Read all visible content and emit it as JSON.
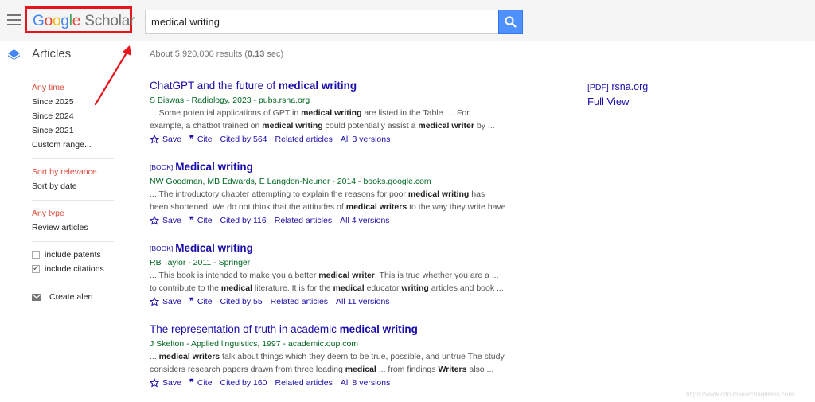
{
  "header": {
    "logo_google": "Google",
    "logo_scholar": "Scholar",
    "search_value": "medical writing"
  },
  "colors": {
    "logo_blue": "#4285f4",
    "logo_red": "#ea4335",
    "logo_yellow": "#fbbc05",
    "logo_green": "#34a853",
    "annotation_red": "#e8141c",
    "search_button": "#4d90fe",
    "link": "#1a0dab",
    "meta_green": "#006621",
    "active_filter": "#dd4b39"
  },
  "icons": {
    "menu": "hamburger-menu-icon",
    "search": "search-icon",
    "articles": "articles-icon",
    "save": "star-icon",
    "cite": "quote-icon",
    "alert": "envelope-icon",
    "annotation": "red-arrow-annotation"
  },
  "section_label": "Articles",
  "result_count": {
    "prefix": "About 5,920,000 results (",
    "time": "0.13",
    "suffix": " sec)"
  },
  "sidebar": {
    "time_filters": [
      "Any time",
      "Since 2025",
      "Since 2024",
      "Since 2021",
      "Custom range..."
    ],
    "sort": [
      "Sort by relevance",
      "Sort by date"
    ],
    "type": [
      "Any type",
      "Review articles"
    ],
    "include_patents": "include patents",
    "include_citations": "include citations",
    "create_alert": "Create alert"
  },
  "results": [
    {
      "tag": "",
      "title_pre": "ChatGPT and the future of ",
      "title_bold": "medical writing",
      "meta": "S Biswas - Radiology, 2023 - pubs.rsna.org",
      "snippet_html": [
        "... Some potential applications of GPT in <b>medical writing</b> are listed in the Table. ... For",
        "example, a chatbot trained on <b>medical writing</b> could potentially assist a <b>medical writer</b> by ..."
      ],
      "save": "Save",
      "cite": "Cite",
      "cited_by": "Cited by 564",
      "related": "Related articles",
      "versions": "All 3 versions"
    },
    {
      "tag": "[BOOK]",
      "title_pre": "",
      "title_bold": "Medical writing",
      "meta": "NW Goodman, MB Edwards, E Langdon-Neuner - 2014 - books.google.com",
      "snippet_html": [
        "... The introductory chapter attempting to explain the reasons for poor <b>medical writing</b> has",
        "been shortened. We do not think that the attitudes of <b>medical writers</b> to the way they write have ..."
      ],
      "save": "Save",
      "cite": "Cite",
      "cited_by": "Cited by 116",
      "related": "Related articles",
      "versions": "All 4 versions"
    },
    {
      "tag": "[BOOK]",
      "title_pre": "",
      "title_bold": "Medical writing",
      "meta": "RB Taylor - 2011 - Springer",
      "snippet_html": [
        "... This book is intended to make you a better <b>medical writer</b>. This is true whether you are a ...",
        "to contribute to the <b>medical</b> literature. It is for the <b>medical</b> educator <b>writing</b> articles and book ..."
      ],
      "save": "Save",
      "cite": "Cite",
      "cited_by": "Cited by 55",
      "related": "Related articles",
      "versions": "All 11 versions"
    },
    {
      "tag": "",
      "title_pre": "The representation of truth in academic ",
      "title_bold": "medical writing",
      "meta": "J Skelton - Applied linguistics, 1997 - academic.oup.com",
      "snippet_html": [
        "... <b>medical writers</b> talk about things which they deem to be true, possible, and untrue The study",
        "considers research papers drawn from three leading <b>medical</b> ... from findings <b>Writers</b> also ..."
      ],
      "save": "Save",
      "cite": "Cite",
      "cited_by": "Cited by 160",
      "related": "Related articles",
      "versions": "All 8 versions"
    }
  ],
  "side_link": {
    "pdf_tag": "[PDF]",
    "domain": "rsna.org",
    "full_view": "Full View"
  },
  "watermark": "https://www.cdn.researchaddress.com"
}
